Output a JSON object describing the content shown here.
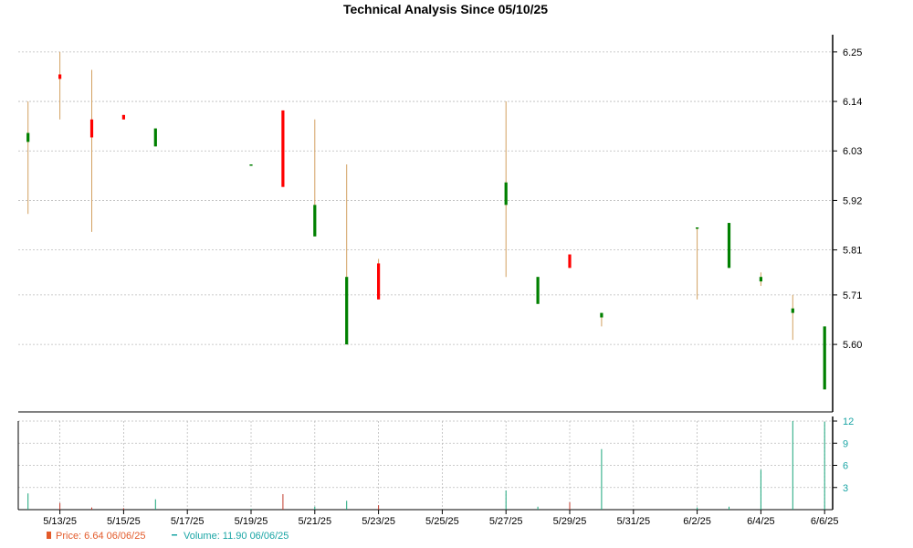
{
  "chart_data": {
    "type": "candlestick",
    "title": "Technical Analysis Since 05/10/25",
    "x_tick_labels": [
      "5/13/25",
      "5/15/25",
      "5/17/25",
      "5/19/25",
      "5/21/25",
      "5/23/25",
      "5/25/25",
      "5/27/25",
      "5/29/25",
      "5/31/25",
      "6/2/25",
      "6/4/25",
      "6/6/25"
    ],
    "price_axis": {
      "ticks": [
        "6.25",
        "6.14",
        "6.03",
        "5.92",
        "5.81",
        "5.71",
        "5.60"
      ],
      "range": [
        5.45,
        6.27
      ]
    },
    "volume_axis": {
      "ticks": [
        "12",
        "9",
        "6",
        "3"
      ],
      "range": [
        0,
        12
      ]
    },
    "colors": {
      "up": "#008000",
      "down": "#ff0000",
      "wick": "#d2a060",
      "grid": "#bbbbbb",
      "volume_up": "#1aa57a",
      "volume_down": "#c0392b"
    },
    "candles": [
      {
        "date": "5/12/25",
        "open": 6.05,
        "high": 6.14,
        "low": 5.89,
        "close": 6.07,
        "volume": 2.2
      },
      {
        "date": "5/13/25",
        "open": 6.2,
        "high": 6.25,
        "low": 6.1,
        "close": 6.19,
        "volume": 0.9
      },
      {
        "date": "5/14/25",
        "open": 6.1,
        "high": 6.21,
        "low": 5.85,
        "close": 6.06,
        "volume": 0.3
      },
      {
        "date": "5/15/25",
        "open": 6.11,
        "high": 6.11,
        "low": 6.1,
        "close": 6.1,
        "volume": 0.2
      },
      {
        "date": "5/16/25",
        "open": 6.04,
        "high": 6.08,
        "low": 6.04,
        "close": 6.08,
        "volume": 1.4
      },
      {
        "date": "5/19/25",
        "open": 6.0,
        "high": 6.0,
        "low": 6.0,
        "close": 6.0,
        "volume": 0.1
      },
      {
        "date": "5/20/25",
        "open": 6.12,
        "high": 6.12,
        "low": 5.95,
        "close": 5.95,
        "volume": 2.1
      },
      {
        "date": "5/21/25",
        "open": 5.84,
        "high": 6.1,
        "low": 5.84,
        "close": 5.91,
        "volume": 0.4
      },
      {
        "date": "5/22/25",
        "open": 5.6,
        "high": 6.0,
        "low": 5.6,
        "close": 5.75,
        "volume": 1.2
      },
      {
        "date": "5/23/25",
        "open": 5.78,
        "high": 5.79,
        "low": 5.7,
        "close": 5.7,
        "volume": 0.6
      },
      {
        "date": "5/27/25",
        "open": 5.91,
        "high": 6.14,
        "low": 5.75,
        "close": 5.96,
        "volume": 2.6
      },
      {
        "date": "5/28/25",
        "open": 5.69,
        "high": 5.75,
        "low": 5.69,
        "close": 5.75,
        "volume": 0.4
      },
      {
        "date": "5/29/25",
        "open": 5.8,
        "high": 5.8,
        "low": 5.77,
        "close": 5.77,
        "volume": 1.0
      },
      {
        "date": "5/30/25",
        "open": 5.66,
        "high": 5.67,
        "low": 5.64,
        "close": 5.67,
        "volume": 8.2
      },
      {
        "date": "6/2/25",
        "open": 5.86,
        "high": 5.86,
        "low": 5.7,
        "close": 5.86,
        "volume": 0.3
      },
      {
        "date": "6/3/25",
        "open": 5.77,
        "high": 5.87,
        "low": 5.77,
        "close": 5.87,
        "volume": 0.4
      },
      {
        "date": "6/4/25",
        "open": 5.74,
        "high": 5.76,
        "low": 5.73,
        "close": 5.75,
        "volume": 5.4
      },
      {
        "date": "6/5/25",
        "open": 5.67,
        "high": 5.71,
        "low": 5.61,
        "close": 5.68,
        "volume": 12.0
      },
      {
        "date": "6/6/25",
        "open": 5.5,
        "high": 5.64,
        "low": 5.5,
        "close": 5.64,
        "volume": 11.9
      }
    ],
    "legend": [
      {
        "marker": "price",
        "label": "Price: 6.64  06/06/25"
      },
      {
        "marker": "volume",
        "label": "Volume: 11.90  06/06/25"
      }
    ],
    "grid": true
  }
}
